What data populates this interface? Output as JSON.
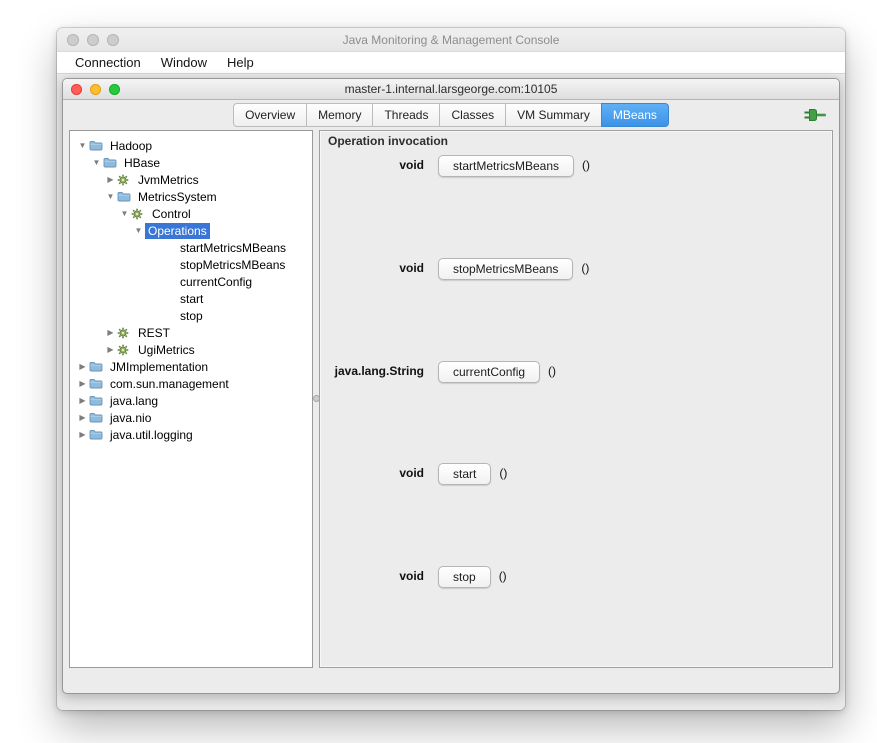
{
  "window": {
    "title": "Java Monitoring & Management Console",
    "menu": [
      "Connection",
      "Window",
      "Help"
    ]
  },
  "connection_window": {
    "title": "master-1.internal.larsgeorge.com:10105",
    "tabs": [
      {
        "label": "Overview",
        "selected": false
      },
      {
        "label": "Memory",
        "selected": false
      },
      {
        "label": "Threads",
        "selected": false
      },
      {
        "label": "Classes",
        "selected": false
      },
      {
        "label": "VM Summary",
        "selected": false
      },
      {
        "label": "MBeans",
        "selected": true
      }
    ],
    "connection_status_icon": "green-plug-icon"
  },
  "mbeans_tree": [
    {
      "label": "Hadoop",
      "depth": 0,
      "expander": "expanded",
      "icon": "folder",
      "selected": false
    },
    {
      "label": "HBase",
      "depth": 1,
      "expander": "expanded",
      "icon": "folder",
      "selected": false
    },
    {
      "label": "JvmMetrics",
      "depth": 2,
      "expander": "collapsed",
      "icon": "bean",
      "selected": false
    },
    {
      "label": "MetricsSystem",
      "depth": 2,
      "expander": "expanded",
      "icon": "folder",
      "selected": false
    },
    {
      "label": "Control",
      "depth": 3,
      "expander": "expanded",
      "icon": "bean",
      "selected": false
    },
    {
      "label": "Operations",
      "depth": 4,
      "expander": "expanded",
      "icon": "none",
      "selected": true
    },
    {
      "label": "startMetricsMBeans",
      "depth": 5,
      "expander": "leaf",
      "icon": "none",
      "selected": false
    },
    {
      "label": "stopMetricsMBeans",
      "depth": 5,
      "expander": "leaf",
      "icon": "none",
      "selected": false
    },
    {
      "label": "currentConfig",
      "depth": 5,
      "expander": "leaf",
      "icon": "none",
      "selected": false
    },
    {
      "label": "start",
      "depth": 5,
      "expander": "leaf",
      "icon": "none",
      "selected": false
    },
    {
      "label": "stop",
      "depth": 5,
      "expander": "leaf",
      "icon": "none",
      "selected": false
    },
    {
      "label": "REST",
      "depth": 2,
      "expander": "collapsed",
      "icon": "bean",
      "selected": false
    },
    {
      "label": "UgiMetrics",
      "depth": 2,
      "expander": "collapsed",
      "icon": "bean",
      "selected": false
    },
    {
      "label": "JMImplementation",
      "depth": 0,
      "expander": "collapsed",
      "icon": "folder",
      "selected": false
    },
    {
      "label": "com.sun.management",
      "depth": 0,
      "expander": "collapsed",
      "icon": "folder",
      "selected": false
    },
    {
      "label": "java.lang",
      "depth": 0,
      "expander": "collapsed",
      "icon": "folder",
      "selected": false
    },
    {
      "label": "java.nio",
      "depth": 0,
      "expander": "collapsed",
      "icon": "folder",
      "selected": false
    },
    {
      "label": "java.util.logging",
      "depth": 0,
      "expander": "collapsed",
      "icon": "folder",
      "selected": false
    }
  ],
  "operations_panel": {
    "title": "Operation invocation",
    "operations": [
      {
        "return_type": "void",
        "name": "startMetricsMBeans",
        "signature": "()"
      },
      {
        "return_type": "void",
        "name": "stopMetricsMBeans",
        "signature": "()"
      },
      {
        "return_type": "java.lang.String",
        "name": "currentConfig",
        "signature": "()"
      },
      {
        "return_type": "void",
        "name": "start",
        "signature": "()"
      },
      {
        "return_type": "void",
        "name": "stop",
        "signature": "()"
      }
    ]
  },
  "colors": {
    "selected_tab": "#3c92e8",
    "tree_selection": "#3a76d6",
    "traffic_red": "#ff5f57",
    "traffic_yellow": "#febc2e",
    "traffic_green": "#28c940",
    "connected_plug_green": "#43a047"
  }
}
